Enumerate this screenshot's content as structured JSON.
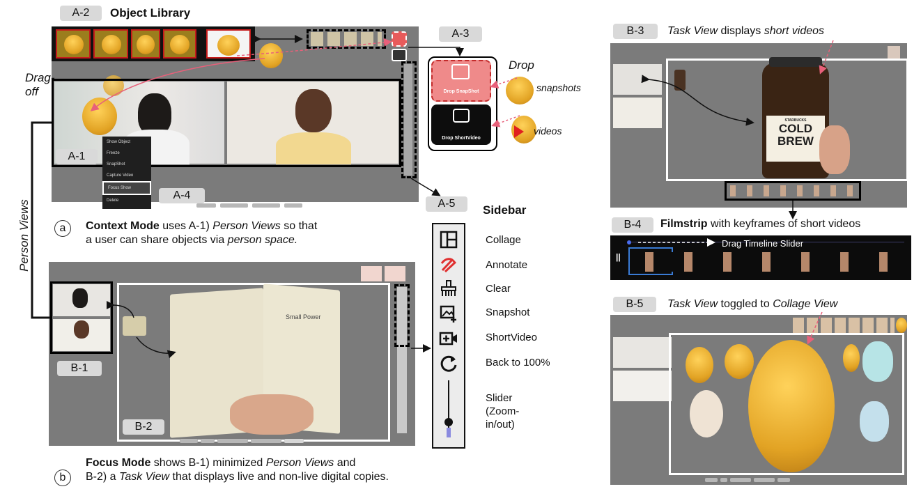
{
  "tags": {
    "a1": "A-1",
    "a2": "A-2",
    "a3": "A-3",
    "a4": "A-4",
    "a5": "A-5",
    "b1": "B-1",
    "b2": "B-2",
    "b3": "B-3",
    "b4": "B-4",
    "b5": "B-5"
  },
  "headings": {
    "object_library": "Object Library",
    "sidebar": "Sidebar",
    "filmstrip": "Filmstrip",
    "filmstrip_rest": "with keyframes of short videos"
  },
  "labels": {
    "drag_off": "Drag-off",
    "drag_off_1": "Drag-",
    "drag_off_2": "off",
    "person_views_vertical": "Person Views",
    "drop": "Drop",
    "snapshots": "snapshots",
    "videos": "videos",
    "drop_snapshot_btn": "Drop SnapShot",
    "drop_shortvideo_btn": "Drop ShortVideo",
    "drag_timeline_slider": "Drag Timeline Slider"
  },
  "context_menu": [
    "Show Object",
    "Freeze",
    "SnapShot",
    "Capture Video",
    "Focus Show",
    "Delete"
  ],
  "sidebar_items": [
    {
      "icon": "collage-icon",
      "label": "Collage"
    },
    {
      "icon": "annotate-icon",
      "label": "Annotate"
    },
    {
      "icon": "clear-icon",
      "label": "Clear"
    },
    {
      "icon": "snapshot-icon",
      "label": "Snapshot"
    },
    {
      "icon": "shortvideo-icon",
      "label": "ShortVideo"
    },
    {
      "icon": "reset-icon",
      "label": "Back to 100%"
    }
  ],
  "slider_label": "Slider (Zoom-in/out)",
  "slider_lines": [
    "Slider",
    "(Zoom-",
    "in/out)"
  ],
  "captions": {
    "a_marker": "a",
    "a_line1_bold": "Context Mode",
    "a_line1_rest": " uses A-1) ",
    "a_line1_it": "Person Views",
    "a_line1_end": " so that",
    "a_line2": "a user can share objects via ",
    "a_line2_it": "person space.",
    "b_marker": "b",
    "b_line1_bold": "Focus Mode",
    "b_line1_rest": " shows B-1) minimized ",
    "b_line1_it": "Person Views",
    "b_line1_end": " and",
    "b_line2_start": "B-2) a ",
    "b_line2_it": "Task View",
    "b_line2_end": " that displays live and non-live digital copies.",
    "b3_it1": "Task View",
    "b3_mid": " displays ",
    "b3_it2": "short videos",
    "b5_it1": "Task View",
    "b5_mid": " toggled to ",
    "b5_it2": "Collage View"
  },
  "bottle_text": {
    "line1": "STARBUCKS",
    "line2": "COLD",
    "line3": "BREW"
  },
  "book_text": "Small Power",
  "colors": {
    "panel": "#7b7b7b",
    "accent_red": "#e03131",
    "tag": "#d9d9d9",
    "arrow_pink": "#e8607a"
  }
}
